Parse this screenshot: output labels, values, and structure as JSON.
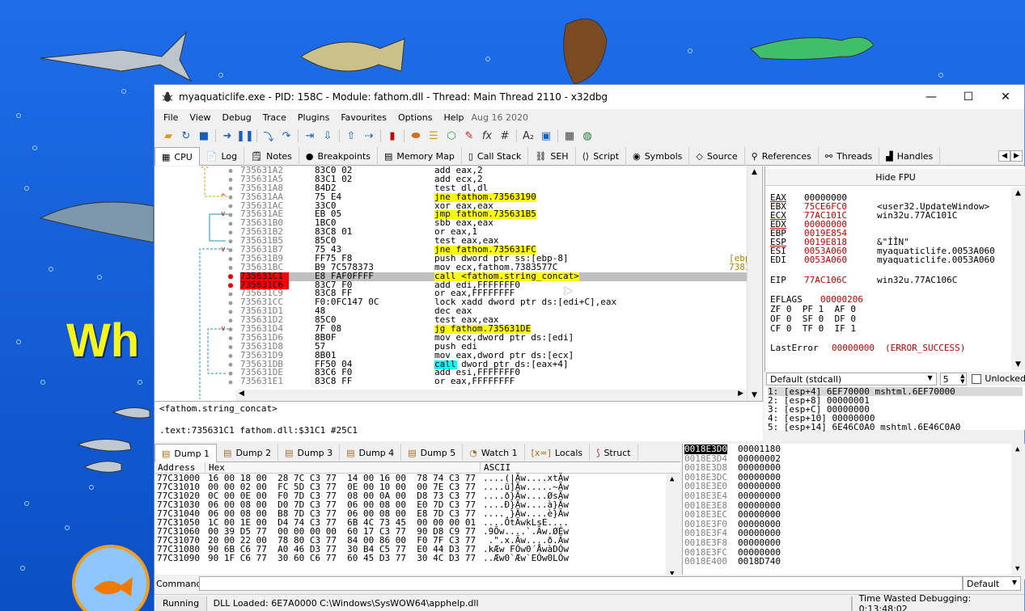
{
  "window": {
    "title": "myaquaticlife.exe - PID: 158C - Module: fathom.dll - Thread: Main Thread 2110 - x32dbg"
  },
  "background": {
    "text": "Wh"
  },
  "menu": [
    "File",
    "View",
    "Debug",
    "Trace",
    "Plugins",
    "Favourites",
    "Options",
    "Help"
  ],
  "menu_date": "Aug 16 2020",
  "tabs": [
    {
      "icon": "cpu-icon",
      "glyph": "▦",
      "label": "CPU"
    },
    {
      "icon": "log-icon",
      "glyph": "📄",
      "label": "Log"
    },
    {
      "icon": "notes-icon",
      "glyph": "🗒",
      "label": "Notes"
    },
    {
      "icon": "breakpoint-icon",
      "glyph": "●",
      "label": "Breakpoints"
    },
    {
      "icon": "memory-icon",
      "glyph": "▤",
      "label": "Memory Map"
    },
    {
      "icon": "callstack-icon",
      "glyph": "▯",
      "label": "Call Stack"
    },
    {
      "icon": "seh-icon",
      "glyph": "⛓",
      "label": "SEH"
    },
    {
      "icon": "script-icon",
      "glyph": "⟨⟩",
      "label": "Script"
    },
    {
      "icon": "symbols-icon",
      "glyph": "◉",
      "label": "Symbols"
    },
    {
      "icon": "source-icon",
      "glyph": "◇",
      "label": "Source"
    },
    {
      "icon": "references-icon",
      "glyph": "⚲",
      "label": "References"
    },
    {
      "icon": "threads-icon",
      "glyph": "⚯",
      "label": "Threads"
    },
    {
      "icon": "handles-icon",
      "glyph": "▟",
      "label": "Handles"
    }
  ],
  "disasm": [
    {
      "addr": "735631A2",
      "bytes": "83C0 02",
      "mnem": "add eax,2"
    },
    {
      "addr": "735631A5",
      "bytes": "83C1 02",
      "mnem": "add ecx,2"
    },
    {
      "addr": "735631A8",
      "bytes": "84D2",
      "mnem": "test dl,dl"
    },
    {
      "addr": "735631AA",
      "bytes": "75 E4",
      "mnem": "jne fathom.73563190",
      "hl": "jmp",
      "arrow": "^"
    },
    {
      "addr": "735631AC",
      "bytes": "33C0",
      "mnem": "xor eax,eax"
    },
    {
      "addr": "735631AE",
      "bytes": "EB 05",
      "mnem": "jmp fathom.735631B5",
      "hl": "jmp",
      "arrow": "v"
    },
    {
      "addr": "735631B0",
      "bytes": "1BC0",
      "mnem": "sbb eax,eax"
    },
    {
      "addr": "735631B2",
      "bytes": "83C8 01",
      "mnem": "or eax,1"
    },
    {
      "addr": "735631B5",
      "bytes": "85C0",
      "mnem": "test eax,eax"
    },
    {
      "addr": "735631B7",
      "bytes": "75 43",
      "mnem": "jne fathom.735631FC",
      "hl": "jmp",
      "arrow": "v"
    },
    {
      "addr": "735631B9",
      "bytes": "FF75 F8",
      "mnem": "push dword ptr ss:[ebp-8]",
      "extra": "[ebp"
    },
    {
      "addr": "735631BC",
      "bytes": "B9 7C578373",
      "mnem": "mov ecx,fathom.7383577C",
      "extra": "7383"
    },
    {
      "addr": "735631C1",
      "bytes": "E8 FAF0FFFF",
      "mnem": "call <fathom.string_concat>",
      "hl": "call",
      "bp": true,
      "sel": true
    },
    {
      "addr": "735631C6",
      "bytes": "83C7 F0",
      "mnem": "add edi,FFFFFFF0",
      "bp": true
    },
    {
      "addr": "735631C9",
      "bytes": "83C8 FF",
      "mnem": "or eax,FFFFFFFF"
    },
    {
      "addr": "735631CC",
      "bytes": "F0:0FC147 0C",
      "mnem": "lock xadd dword ptr ds:[edi+C],eax"
    },
    {
      "addr": "735631D1",
      "bytes": "48",
      "mnem": "dec eax"
    },
    {
      "addr": "735631D2",
      "bytes": "85C0",
      "mnem": "test eax,eax"
    },
    {
      "addr": "735631D4",
      "bytes": "7F 08",
      "mnem": "jg fathom.735631DE",
      "hl": "jmp",
      "arrow": "v"
    },
    {
      "addr": "735631D6",
      "bytes": "8B0F",
      "mnem": "mov ecx,dword ptr ds:[edi]"
    },
    {
      "addr": "735631D8",
      "bytes": "57",
      "mnem": "push edi"
    },
    {
      "addr": "735631D9",
      "bytes": "8B01",
      "mnem": "mov eax,dword ptr ds:[ecx]"
    },
    {
      "addr": "735631DB",
      "bytes": "FF50 04",
      "mnem": "call dword ptr ds:[eax+4]",
      "hl": "callind"
    },
    {
      "addr": "735631DE",
      "bytes": "83C6 F0",
      "mnem": "add esi,FFFFFFF0"
    },
    {
      "addr": "735631E1",
      "bytes": "83C8 FF",
      "mnem": "or eax,FFFFFFFF"
    }
  ],
  "info": {
    "line1": "<fathom.string_concat>",
    "line2": ".text:735631C1 fathom.dll:$31C1 #25C1"
  },
  "registers": {
    "hide_fpu": "Hide FPU",
    "list": [
      {
        "n": "EAX",
        "v": "00000000",
        "c": "",
        "red": false
      },
      {
        "n": "EBX",
        "v": "75CE6FC0",
        "c": "<user32.UpdateWindow>",
        "red": true
      },
      {
        "n": "ECX",
        "v": "77AC101C",
        "c": "win32u.77AC101C",
        "red": true
      },
      {
        "n": "EDX",
        "v": "00000000",
        "c": "",
        "red": true
      },
      {
        "n": "EBP",
        "v": "0019E854",
        "c": "",
        "red": true
      },
      {
        "n": "ESP",
        "v": "0019E818",
        "c": "&\"ÌÎN\"",
        "red": true
      },
      {
        "n": "ESI",
        "v": "0053A060",
        "c": "myaquaticlife.0053A060",
        "red": true
      },
      {
        "n": "EDI",
        "v": "0053A060",
        "c": "myaquaticlife.0053A060",
        "red": true
      }
    ],
    "eip": {
      "n": "EIP",
      "v": "77AC106C",
      "c": "win32u.77AC106C"
    },
    "eflags": {
      "n": "EFLAGS",
      "v": "00000206"
    },
    "flags": [
      "ZF 0  PF 1  AF 0",
      "OF 0  SF 0  DF 0",
      "CF 0  TF 0  IF 1"
    ],
    "lasterror": {
      "n": "LastError",
      "v": "00000000",
      "c": "(ERROR_SUCCESS)"
    }
  },
  "callconv": {
    "value": "Default (stdcall)",
    "count": "5",
    "unlocked": "Unlocked"
  },
  "stack_args": [
    "1: [esp+4] 6EF70000 mshtml.6EF70000",
    "2: [esp+8] 00000001",
    "3: [esp+C] 00000000",
    "4: [esp+10] 00000000",
    "5: [esp+14] 6E46C0A0 mshtml.6E46C0A0"
  ],
  "dump_tabs": [
    {
      "icon": "dump-icon",
      "label": "Dump 1"
    },
    {
      "icon": "dump-icon",
      "label": "Dump 2"
    },
    {
      "icon": "dump-icon",
      "label": "Dump 3"
    },
    {
      "icon": "dump-icon",
      "label": "Dump 4"
    },
    {
      "icon": "dump-icon",
      "label": "Dump 5"
    },
    {
      "icon": "watch-icon",
      "label": "Watch 1"
    },
    {
      "icon": "locals-icon",
      "label": "Locals"
    },
    {
      "icon": "struct-icon",
      "label": "Struct"
    }
  ],
  "dump_headers": [
    "Address",
    "Hex",
    "ASCII"
  ],
  "dump_rows": [
    {
      "a": "77C31000",
      "h": "16 00 18 00  28 7C C3 77  14 00 16 00  78 74 C3 77",
      "x": "....(|Ãw....xtÃw"
    },
    {
      "a": "77C31010",
      "h": "00 00 02 00  FC 5D C3 77  0E 00 10 00  00 7E C3 77",
      "x": "....ü]Ãw.....~Ãw"
    },
    {
      "a": "77C31020",
      "h": "0C 00 0E 00  F0 7D C3 77  08 00 0A 00  D8 73 C3 77",
      "x": "....ð}Ãw....ØsÃw"
    },
    {
      "a": "77C31030",
      "h": "06 00 08 00  D0 7D C3 77  06 00 08 00  E0 7D C3 77",
      "x": "....Ð}Ãw....à}Ãw"
    },
    {
      "a": "77C31040",
      "h": "06 00 08 00  B8 7D C3 77  06 00 08 00  E8 7D C3 77",
      "x": "....¸}Ãw....è}Ãw"
    },
    {
      "a": "77C31050",
      "h": "1C 00 1E 00  D4 74 C3 77  6B 4C 73 45  00 00 00 01",
      "x": "....ÔtÃwkLsE...."
    },
    {
      "a": "77C31060",
      "h": "00 39 D5 77  00 00 00 00  60 17 C3 77  90 D8 C9 77",
      "x": ".9Õw....`.Ãw.ØÉw"
    },
    {
      "a": "77C31070",
      "h": "20 00 22 00  78 80 C3 77  84 00 86 00  F0 7F C3 77",
      "x": " .\".x.Ãw....ð.Ãw"
    },
    {
      "a": "77C31080",
      "h": "90 6B C6 77  A0 46 D3 77  30 B4 C5 77  E0 44 D3 77",
      "x": ".kÆw FÓw0´ÅwàDÓw"
    },
    {
      "a": "77C31090",
      "h": "90 1F C6 77  30 60 C6 77  60 45 D3 77  30 4C D3 77",
      "x": "..Æw0`Æw`EÓw0LÓw"
    }
  ],
  "stack_rows": [
    {
      "a": "0018E3D0",
      "v": "00001180",
      "sel": true
    },
    {
      "a": "0018E3D4",
      "v": "00000002"
    },
    {
      "a": "0018E3D8",
      "v": "00000000"
    },
    {
      "a": "0018E3DC",
      "v": "00000000"
    },
    {
      "a": "0018E3E0",
      "v": "00000000"
    },
    {
      "a": "0018E3E4",
      "v": "00000000"
    },
    {
      "a": "0018E3E8",
      "v": "00000000"
    },
    {
      "a": "0018E3EC",
      "v": "00000000"
    },
    {
      "a": "0018E3F0",
      "v": "00000000"
    },
    {
      "a": "0018E3F4",
      "v": "00000000"
    },
    {
      "a": "0018E3F8",
      "v": "00000000"
    },
    {
      "a": "0018E3FC",
      "v": "00000000"
    },
    {
      "a": "0018E400",
      "v": "0018D740"
    }
  ],
  "command": {
    "label": "Command:",
    "default": "Default"
  },
  "status": {
    "state": "Running",
    "message": "DLL Loaded: 6E7A0000 C:\\Windows\\SysWOW64\\apphelp.dll",
    "time": "Time Wasted Debugging: 0:13:48:02"
  }
}
